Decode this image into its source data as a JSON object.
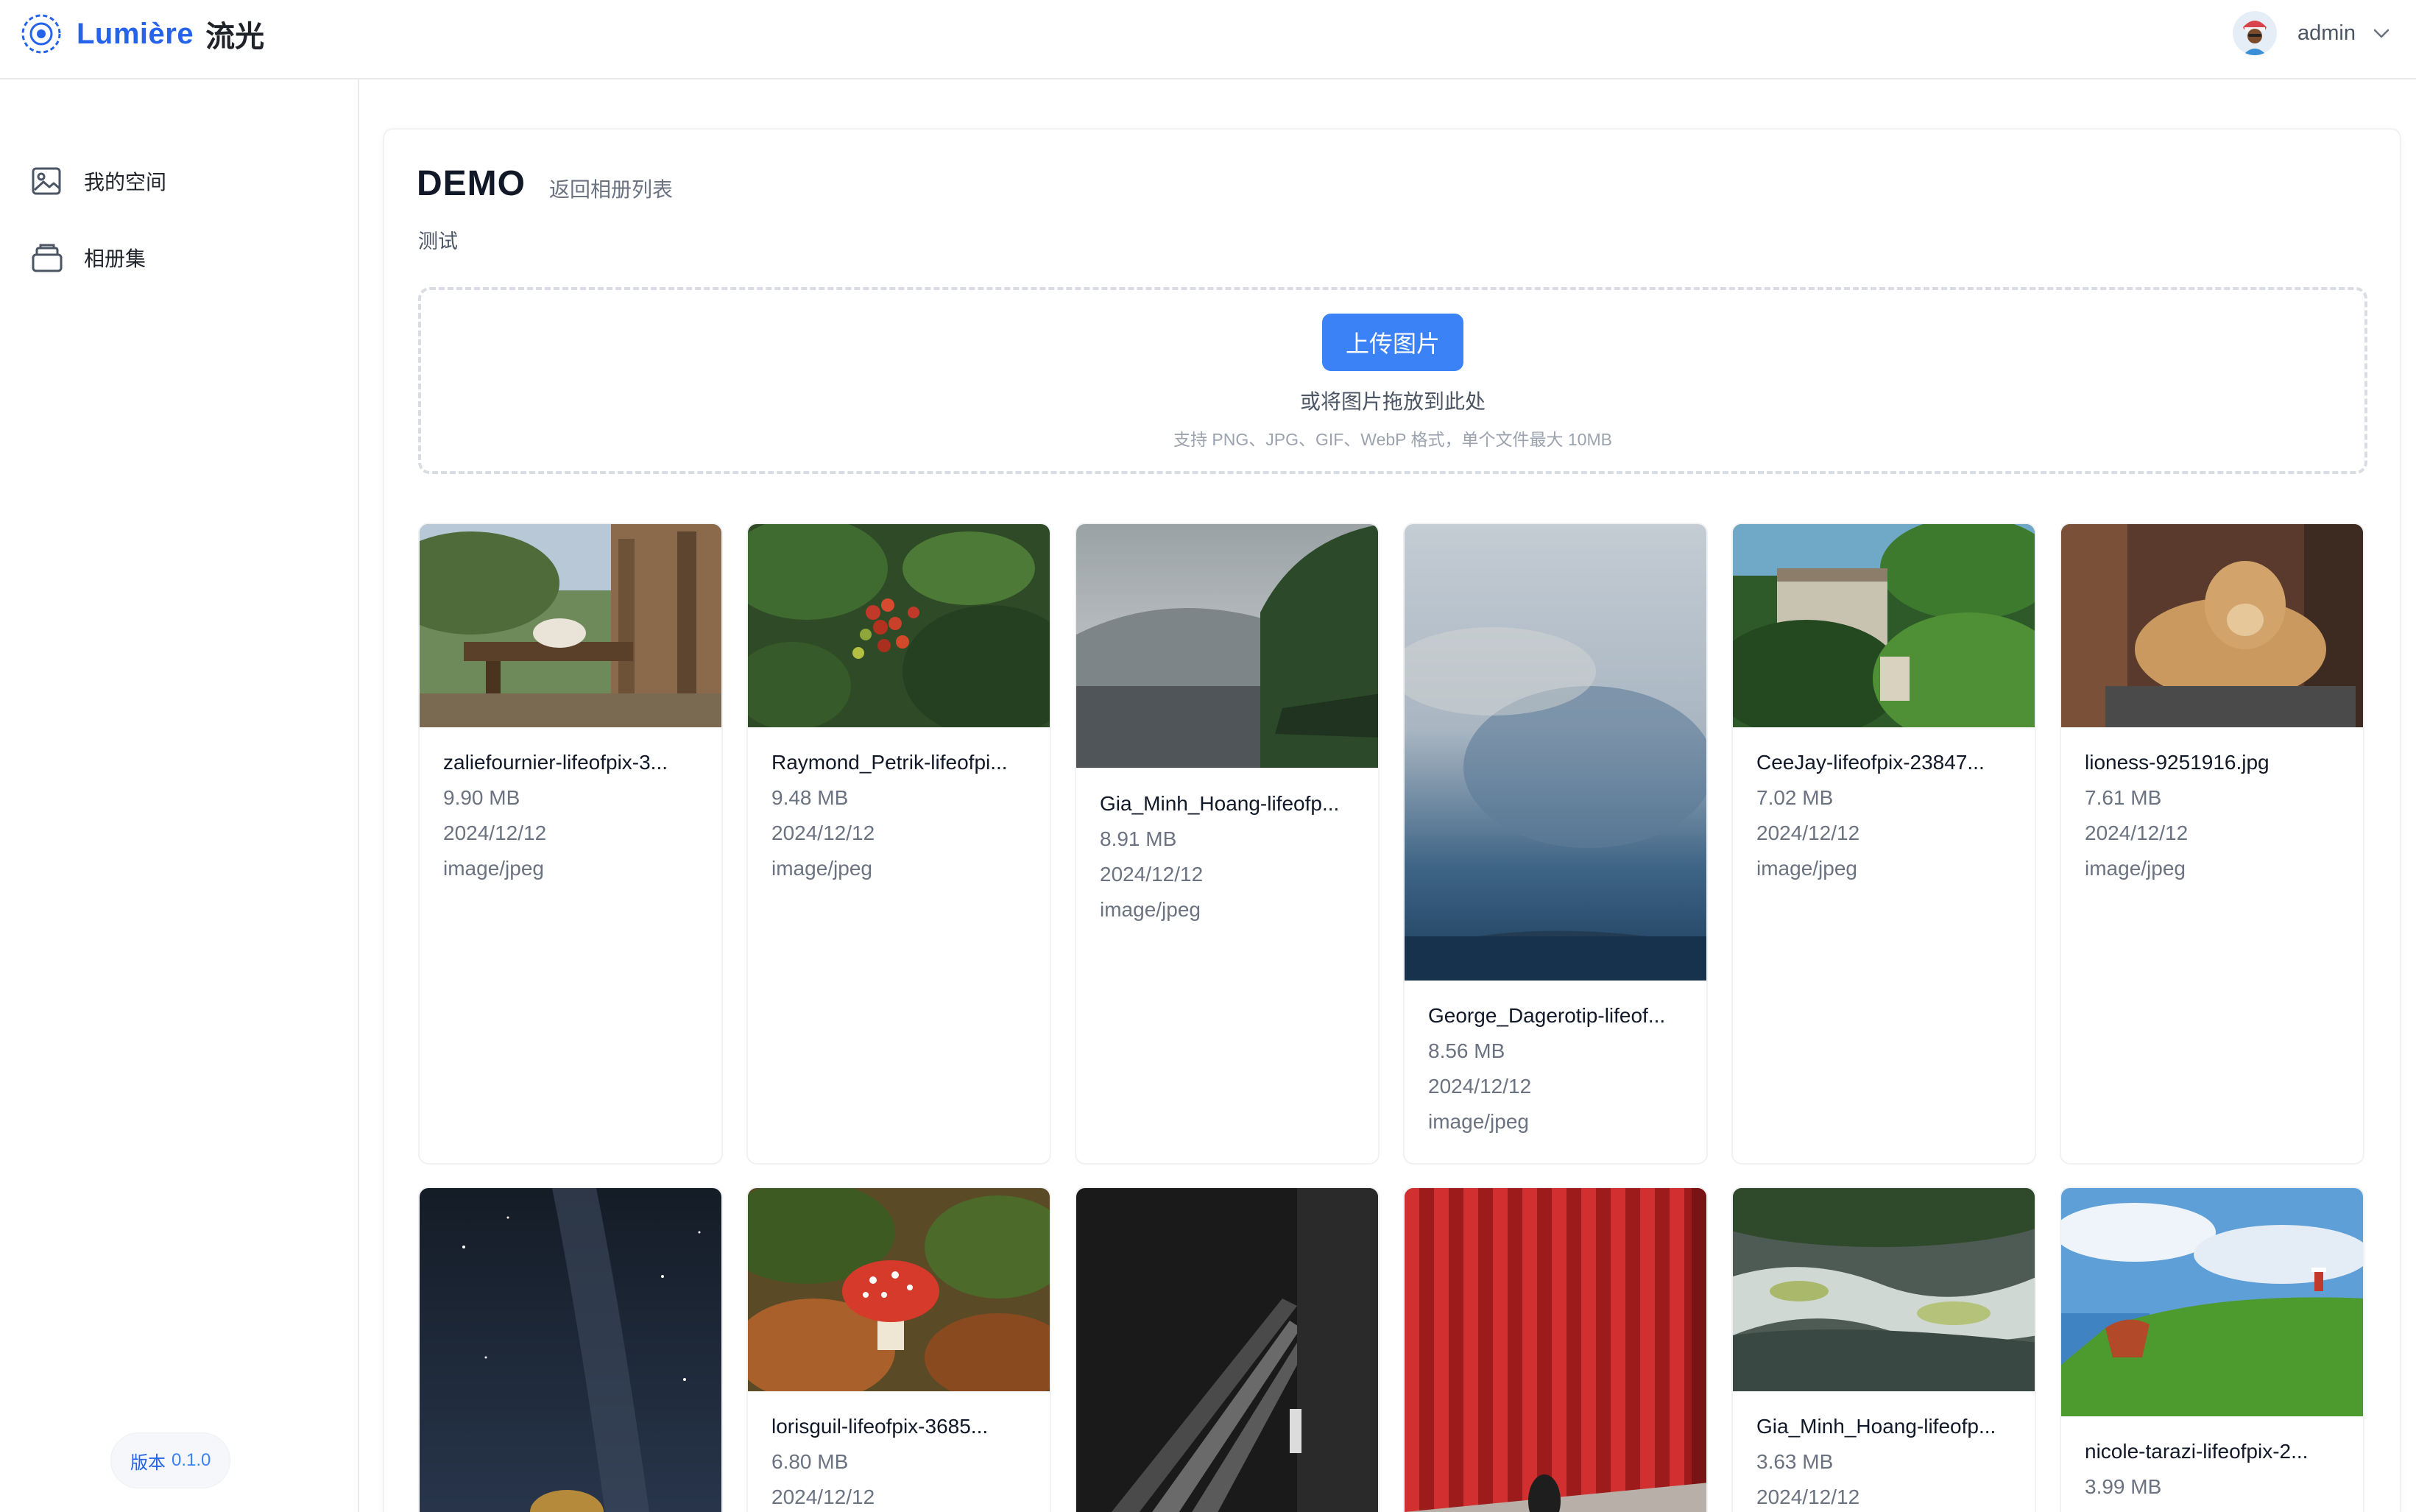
{
  "header": {
    "brand_name": "Lumière",
    "brand_cn": "流光",
    "username": "admin"
  },
  "sidebar": {
    "items": [
      {
        "label": "我的空间",
        "icon": "image-icon"
      },
      {
        "label": "相册集",
        "icon": "album-stack-icon"
      }
    ],
    "version_label": "版本",
    "version_number": "0.1.0"
  },
  "album": {
    "title": "DEMO",
    "back_label": "返回相册列表",
    "description": "测试"
  },
  "upload": {
    "button_label": "上传图片",
    "drop_hint": "或将图片拖放到此处",
    "format_hint": "支持 PNG、JPG、GIF、WebP 格式，单个文件最大 10MB"
  },
  "images": [
    {
      "name": "zaliefournier-lifeofpix-3...",
      "size": "9.90 MB",
      "date": "2024/12/12",
      "type": "image/jpeg",
      "scene": "cat on wooden bench"
    },
    {
      "name": "Raymond_Petrik-lifeofpi...",
      "size": "9.48 MB",
      "date": "2024/12/12",
      "type": "image/jpeg",
      "scene": "coffee berries"
    },
    {
      "name": "Gia_Minh_Hoang-lifeofp...",
      "size": "8.91 MB",
      "date": "2024/12/12",
      "type": "image/jpeg",
      "scene": "misty lake forest"
    },
    {
      "name": "George_Dagerotip-lifeof...",
      "size": "8.56 MB",
      "date": "2024/12/12",
      "type": "image/jpeg",
      "scene": "cloudy sky over sea"
    },
    {
      "name": "CeeJay-lifeofpix-23847...",
      "size": "7.02 MB",
      "date": "2024/12/12",
      "type": "image/jpeg",
      "scene": "green garden house"
    },
    {
      "name": "lioness-9251916.jpg",
      "size": "7.61 MB",
      "date": "2024/12/12",
      "type": "image/jpeg",
      "scene": "lioness on rock"
    },
    {
      "name": "",
      "size": "",
      "date": "",
      "type": "",
      "scene": "night sky milky way"
    },
    {
      "name": "lorisguil-lifeofpix-3685...",
      "size": "6.80 MB",
      "date": "2024/12/12",
      "type": "",
      "scene": "red mushroom"
    },
    {
      "name": "",
      "size": "",
      "date": "",
      "type": "",
      "scene": "dark corridor"
    },
    {
      "name": "",
      "size": "",
      "date": "",
      "type": "",
      "scene": "red columns wall"
    },
    {
      "name": "Gia_Minh_Hoang-lifeofp...",
      "size": "3.63 MB",
      "date": "2024/12/12",
      "type": "",
      "scene": "river rapids"
    },
    {
      "name": "nicole-tarazi-lifeofpix-2...",
      "size": "3.99 MB",
      "date": "",
      "type": "",
      "scene": "green coastal hill"
    }
  ]
}
